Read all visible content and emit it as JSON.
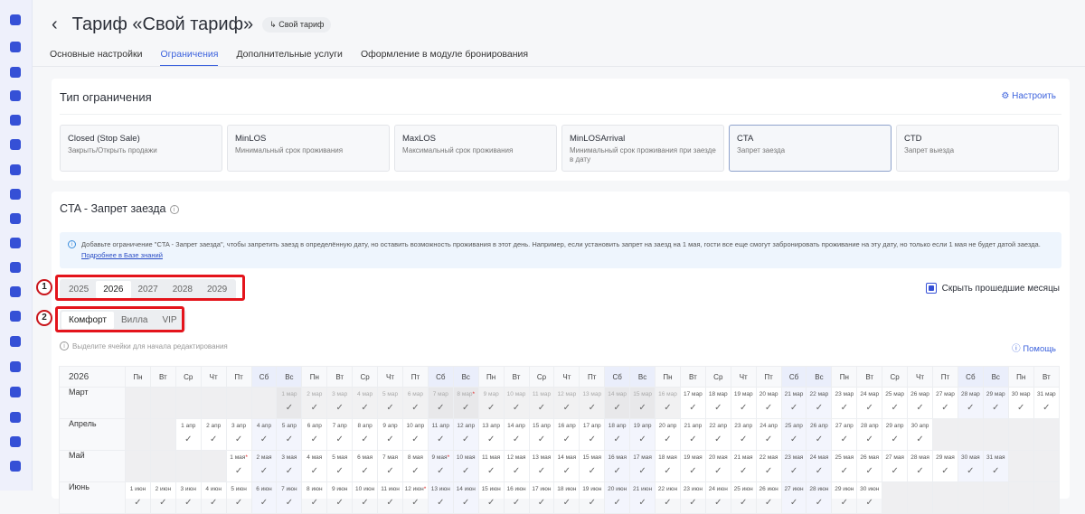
{
  "header": {
    "title": "Тариф «Свой тариф»",
    "badge": "↳ Свой тариф",
    "back": "‹"
  },
  "tabs": [
    "Основные настройки",
    "Ограничения",
    "Дополнительные услуги",
    "Оформление в модуле бронирования"
  ],
  "restriction_type": {
    "title": "Тип ограничения",
    "configure": "Настроить",
    "types": [
      {
        "name": "Closed (Stop Sale)",
        "desc": "Закрыть/Открыть продажи"
      },
      {
        "name": "MinLOS",
        "desc": "Минимальный срок проживания"
      },
      {
        "name": "MaxLOS",
        "desc": "Максимальный срок проживания"
      },
      {
        "name": "MinLOSArrival",
        "desc": "Минимальный срок проживания при заезде в дату"
      },
      {
        "name": "CTA",
        "desc": "Запрет заезда"
      },
      {
        "name": "CTD",
        "desc": "Запрет выезда"
      }
    ]
  },
  "cta": {
    "title": "CTA - Запрет заезда",
    "notice": "Добавьте ограничение \"CTA - Запрет заезда\", чтобы запретить заезд в определённую дату, но оставить возможность проживания в этот день. Например, если установить запрет на заезд на 1 мая, гости все еще смогут забронировать проживание на эту дату, но только если 1 мая не будет датой заезда.",
    "notice_link": "Подробнее в Базе знаний",
    "years": [
      "2025",
      "2026",
      "2027",
      "2028",
      "2029"
    ],
    "rooms": [
      "Комфорт",
      "Вилла",
      "VIP"
    ],
    "hide_past": "Скрыть прошедшие месяцы",
    "hint": "Выделите ячейки для начала редактирования",
    "help": "Помощь",
    "annotations": [
      "1",
      "2"
    ]
  },
  "calendar": {
    "year": "2026",
    "weekdays": [
      "Пн",
      "Вт",
      "Ср",
      "Чт",
      "Пт",
      "Сб",
      "Вс"
    ],
    "check": "✓",
    "months": [
      {
        "name": "Март",
        "abbr": "мар",
        "days": 31,
        "offset": 6,
        "past_until": 16,
        "holidays": [
          8
        ]
      },
      {
        "name": "Апрель",
        "abbr": "апр",
        "days": 30,
        "offset": 2,
        "past_until": 0,
        "holidays": []
      },
      {
        "name": "Май",
        "abbr": "мая",
        "days": 31,
        "offset": 4,
        "past_until": 0,
        "holidays": [
          1,
          9
        ]
      },
      {
        "name": "Июнь",
        "abbr": "июн",
        "days": 30,
        "offset": 0,
        "past_until": 0,
        "holidays": [
          12
        ]
      }
    ]
  }
}
